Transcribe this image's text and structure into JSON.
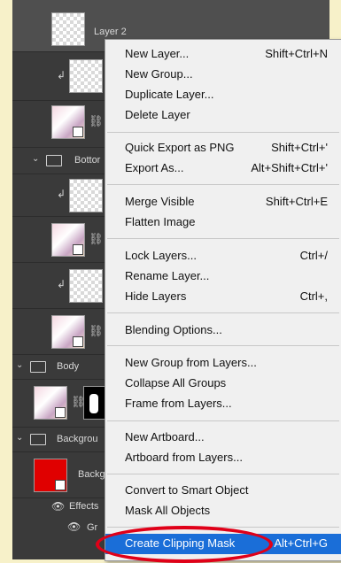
{
  "layers_panel": {
    "rows": [
      {
        "id": "layer2",
        "name": "Layer 2"
      },
      {
        "id": "clip1",
        "name": ""
      },
      {
        "id": "art1",
        "name": ""
      },
      {
        "id": "bottom_group",
        "name": "Bottor"
      },
      {
        "id": "clip2",
        "name": ""
      },
      {
        "id": "art2",
        "name": ""
      },
      {
        "id": "clip3",
        "name": ""
      },
      {
        "id": "art3",
        "name": ""
      },
      {
        "id": "body_group",
        "name": "Body"
      },
      {
        "id": "art4",
        "name": ""
      },
      {
        "id": "background_group",
        "name": "Backgrou"
      },
      {
        "id": "bg_layer",
        "name": "Backg"
      },
      {
        "id": "effects",
        "name": "Effects"
      },
      {
        "id": "gr",
        "name": "Gr"
      }
    ]
  },
  "context_menu": {
    "items": [
      {
        "label": "New Layer...",
        "shortcut": "Shift+Ctrl+N"
      },
      {
        "label": "New Group...",
        "shortcut": ""
      },
      {
        "label": "Duplicate Layer...",
        "shortcut": ""
      },
      {
        "label": "Delete Layer",
        "shortcut": ""
      },
      {
        "label": "Quick Export as PNG",
        "shortcut": "Shift+Ctrl+'"
      },
      {
        "label": "Export As...",
        "shortcut": "Alt+Shift+Ctrl+'"
      },
      {
        "label": "Merge Visible",
        "shortcut": "Shift+Ctrl+E"
      },
      {
        "label": "Flatten Image",
        "shortcut": ""
      },
      {
        "label": "Lock Layers...",
        "shortcut": "Ctrl+/"
      },
      {
        "label": "Rename Layer...",
        "shortcut": ""
      },
      {
        "label": "Hide Layers",
        "shortcut": "Ctrl+,"
      },
      {
        "label": "Blending Options...",
        "shortcut": ""
      },
      {
        "label": "New Group from Layers...",
        "shortcut": ""
      },
      {
        "label": "Collapse All Groups",
        "shortcut": ""
      },
      {
        "label": "Frame from Layers...",
        "shortcut": ""
      },
      {
        "label": "New Artboard...",
        "shortcut": ""
      },
      {
        "label": "Artboard from Layers...",
        "shortcut": ""
      },
      {
        "label": "Convert to Smart Object",
        "shortcut": ""
      },
      {
        "label": "Mask All Objects",
        "shortcut": ""
      },
      {
        "label": "Create Clipping Mask",
        "shortcut": "Alt+Ctrl+G"
      }
    ],
    "highlighted_item": "Create Clipping Mask"
  },
  "colors": {
    "highlight": "#1a6ed8",
    "annotation_ring": "#e00018",
    "panel_bg": "#3a3a3a",
    "page_bg": "#f7f1c9"
  },
  "icons": [
    "eye-icon",
    "folder-icon",
    "chain-link-icon",
    "clip-arrow-icon",
    "smart-object-icon",
    "chevron-down-icon"
  ]
}
